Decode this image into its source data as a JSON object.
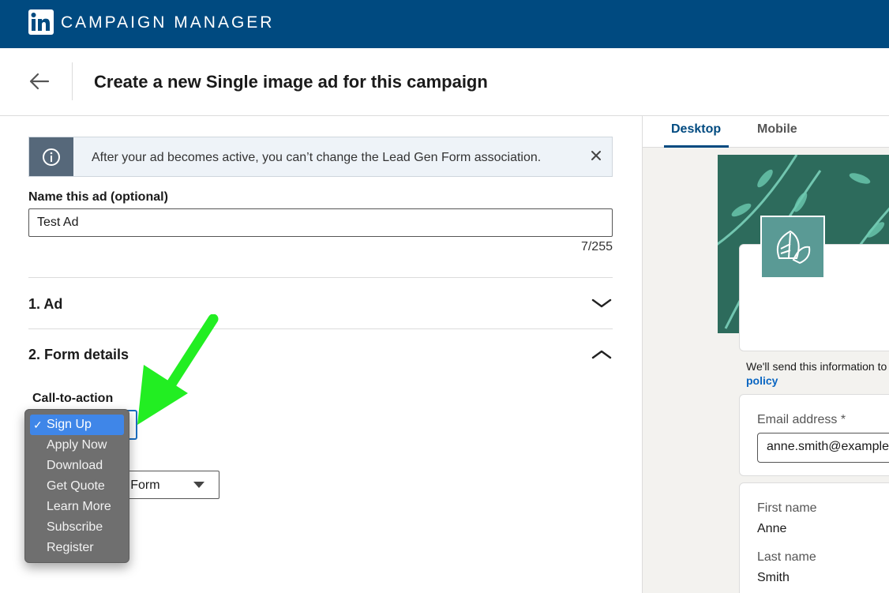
{
  "topbar": {
    "app_title": "CAMPAIGN MANAGER",
    "logo_icon": "linkedin-logo"
  },
  "header": {
    "title": "Create a new Single image ad for this campaign",
    "back_icon": "arrow-left-icon"
  },
  "banner": {
    "text": "After your ad becomes active, you can’t change the Lead Gen Form association.",
    "icon": "info-icon",
    "close_icon": "close-icon"
  },
  "ad_name": {
    "label": "Name this ad (optional)",
    "value": "Test Ad",
    "char_count": "7/255"
  },
  "sections": [
    {
      "title": "1.  Ad",
      "state": "collapsed"
    },
    {
      "title": "2.  Form details",
      "state": "expanded"
    }
  ],
  "form_details": {
    "cta_label": "Call-to-action",
    "cta_options": [
      "Sign Up",
      "Apply Now",
      "Download",
      "Get Quote",
      "Learn More",
      "Subscribe",
      "Register"
    ],
    "cta_selected": "Sign Up",
    "lead_form_value": "en Form"
  },
  "preview": {
    "tabs": [
      "Desktop",
      "Mobile"
    ],
    "active_tab": "Desktop",
    "note_text": "We'll send this information to",
    "note_link": "policy",
    "fields": {
      "email_label": "Email address *",
      "email_value": "anne.smith@example",
      "first_name_label": "First name",
      "first_name_value": "Anne",
      "last_name_label": "Last name",
      "last_name_value": "Smith"
    }
  },
  "colors": {
    "topbar": "#004a80",
    "accent": "#0a66c2",
    "arrow": "#22ee22",
    "dropdown_bg": "#6f6f6f",
    "dropdown_selected": "#3f86e8"
  }
}
